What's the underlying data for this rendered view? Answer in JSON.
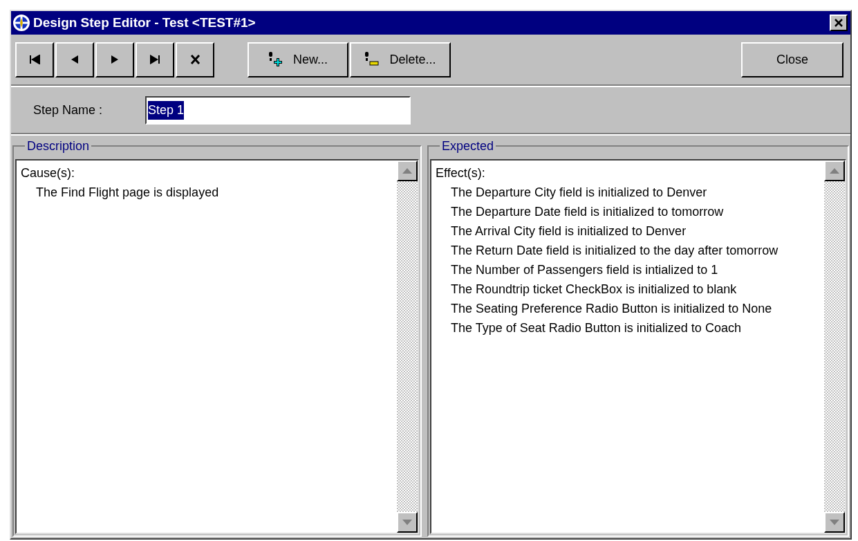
{
  "window": {
    "title": "Design Step Editor - Test <TEST#1>"
  },
  "nav_buttons": [
    {
      "kind": "first"
    },
    {
      "kind": "prev"
    },
    {
      "kind": "next"
    },
    {
      "kind": "last"
    },
    {
      "kind": "cancel"
    }
  ],
  "action_buttons": [
    {
      "kind": "new",
      "label": "New..."
    },
    {
      "kind": "delete",
      "label": "Delete..."
    }
  ],
  "close_button": "Close",
  "step_name": {
    "label": "Step Name :",
    "value": "Step 1",
    "text_selected": true
  },
  "panes": [
    {
      "title": "Description",
      "heading": "Cause(s):",
      "lines": [
        "The Find Flight page is displayed"
      ]
    },
    {
      "title": "Expected",
      "heading": "Effect(s):",
      "lines": [
        "The Departure City field is initialized to Denver",
        "The Departure Date field is initialized to tomorrow",
        "The Arrival City field is initialized to Denver",
        "The Return Date field is initialized to the day after tomorrow",
        "The Number of Passengers field is intialized to 1",
        "The Roundtrip ticket CheckBox is initialized to blank",
        "The Seating Preference Radio Button is initialized to None",
        "The Type of Seat Radio Button is initialized to Coach"
      ]
    }
  ]
}
